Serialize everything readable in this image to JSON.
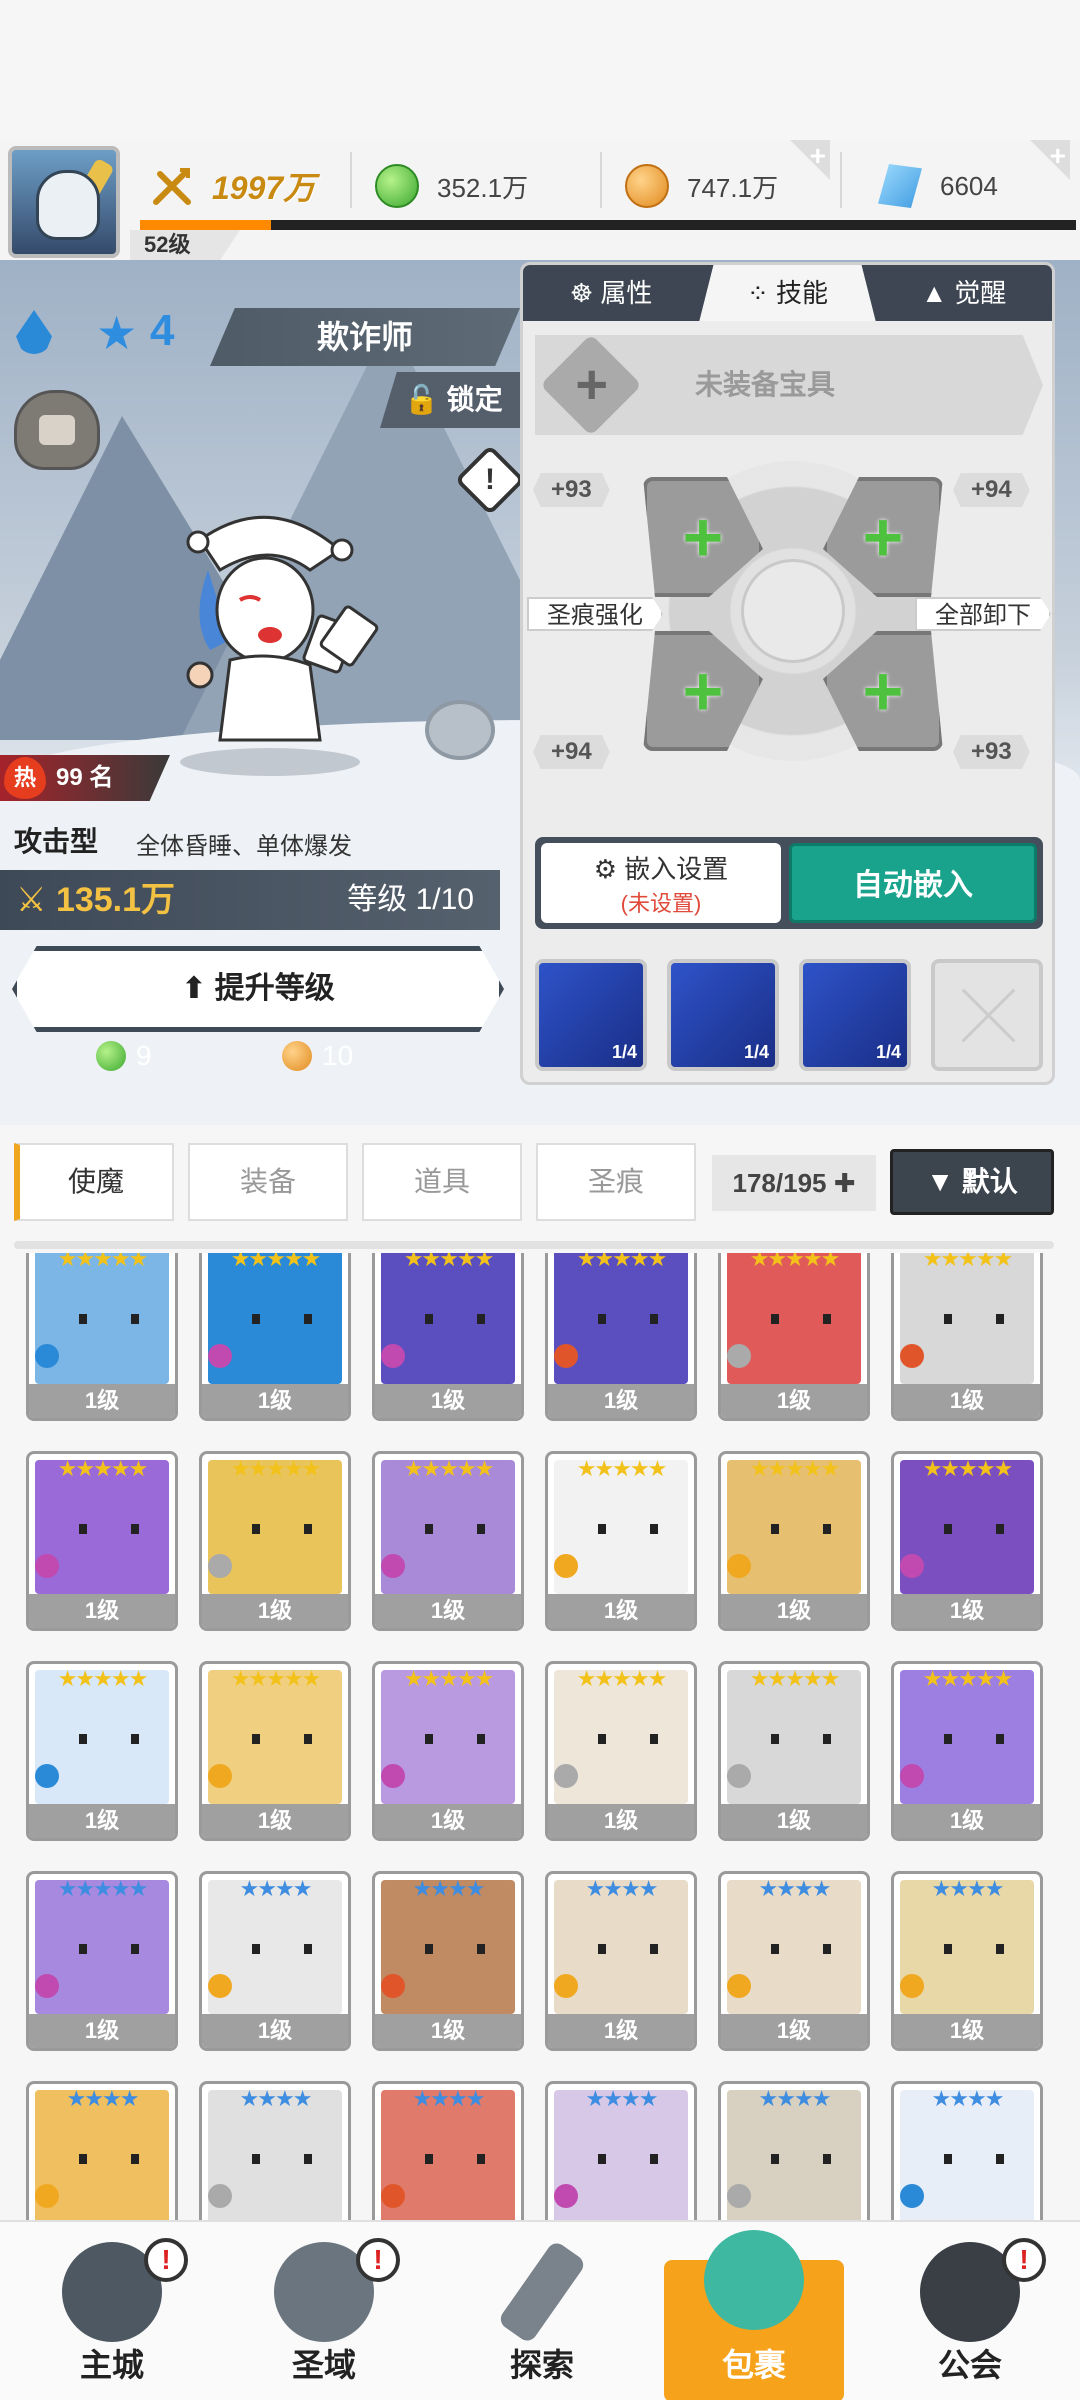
{
  "resources": {
    "player_level": "52级",
    "power": "1997万",
    "green_currency": "352.1万",
    "gold_currency": "747.1万",
    "diamond": "6604",
    "plus": "+",
    "level_progress": 0.14
  },
  "hero": {
    "stars": "4",
    "name": "欺诈师",
    "lock_label": "锁定",
    "warn": "!",
    "hot_icon": "热",
    "rank": "99 名",
    "type": "攻击型",
    "desc": "全体昏睡、单体爆发",
    "power": "135.1万",
    "level": "等级 1/10",
    "upgrade_label": "提升等级",
    "cost_green": "9",
    "cost_gold": "10"
  },
  "panel": {
    "tabs": [
      "属性",
      "技能",
      "觉醒"
    ],
    "artifact_label": "未装备宝具",
    "plus": "+",
    "tag_tl": "+93",
    "tag_tr": "+94",
    "tag_bl": "+94",
    "tag_br": "+93",
    "enhance_label": "圣痕强化",
    "unequip_label": "全部卸下",
    "embed_label": "嵌入设置",
    "embed_status": "(未设置)",
    "auto_label": "自动嵌入",
    "card_count": "1/4"
  },
  "inventory": {
    "tabs": [
      "使魔",
      "装备",
      "道具",
      "圣痕"
    ],
    "count": "178/195 ✚",
    "sort_label": "▼ 默认",
    "unit_level": "1级",
    "five_star": "★★★★★",
    "four_star": "★★★★"
  },
  "nav": {
    "items": [
      "主城",
      "圣域",
      "探索",
      "包裹",
      "公会"
    ],
    "badge": "!"
  }
}
